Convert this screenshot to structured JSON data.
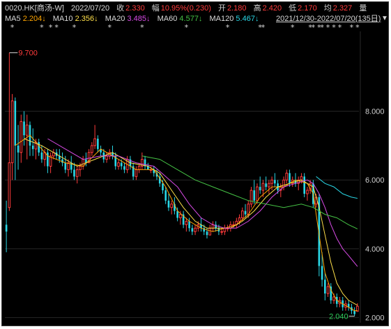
{
  "header": {
    "symbol": "0020.HK[商汤-W]",
    "date": "2022/07/20",
    "close_label": "收",
    "close_value": "2.330",
    "change_label": "幅",
    "change_value": "10.95%(0.230)",
    "open_label": "开",
    "open_value": "2.180",
    "high_label": "高",
    "high_value": "2.420",
    "low_label": "低",
    "low_value": "2.170",
    "avg_label": "均",
    "avg_value": "2.327",
    "volume_label": "量"
  },
  "ma_row": {
    "ma5_label": "MA5",
    "ma5_value": "2.204↓",
    "ma10_label": "MA10",
    "ma10_value": "2.356↓",
    "ma20_label": "MA20",
    "ma20_value": "3.485↓",
    "ma60_label": "MA60",
    "ma60_value": "4.577↓",
    "ma120_label": "MA120",
    "ma120_value": "5.467↓",
    "range_text": "2021/12/30-2022/07/20(135日)",
    "range_caret": "▼"
  },
  "colors": {
    "background": "#000000",
    "up_candle": "#ff3b3b",
    "down_candle": "#29d7e6",
    "ma5": "#ffa500",
    "ma10": "#ffe04a",
    "ma20": "#d84be6",
    "ma60": "#45c245",
    "ma120": "#29d7e6"
  },
  "chart_data": {
    "type": "candlestick",
    "y_ticks": [
      "8.000",
      "6.000",
      "4.000",
      "2.000"
    ],
    "y_tick_values": [
      8,
      6,
      4,
      2
    ],
    "ylim": [
      1.85,
      10.2
    ],
    "annotations": {
      "high_label": "9.700",
      "high_value": 9.7,
      "low_label": "2.040",
      "low_value": 2.04
    },
    "star_marker": "*",
    "star_positions": [
      2,
      12,
      15,
      17,
      23,
      35,
      46,
      61,
      75,
      86,
      87,
      97,
      103,
      104,
      106,
      107,
      109,
      111,
      113,
      117,
      119
    ],
    "candles": [
      [
        4.7,
        5.4,
        3.9,
        4.5
      ],
      [
        5.2,
        9.7,
        5.1,
        6.5
      ],
      [
        6.5,
        8.5,
        6.0,
        8.3
      ],
      [
        8.3,
        8.4,
        6.0,
        7.0
      ],
      [
        7.0,
        7.6,
        6.3,
        6.8
      ],
      [
        6.8,
        7.9,
        6.5,
        7.7
      ],
      [
        7.7,
        8.0,
        7.0,
        7.3
      ],
      [
        7.3,
        7.9,
        6.6,
        7.6
      ],
      [
        7.6,
        7.7,
        6.7,
        7.0
      ],
      [
        7.0,
        7.5,
        6.7,
        6.9
      ],
      [
        6.9,
        7.2,
        6.6,
        7.1
      ],
      [
        7.1,
        7.2,
        6.7,
        6.8
      ],
      [
        6.8,
        7.0,
        6.5,
        6.6
      ],
      [
        6.6,
        6.9,
        6.4,
        6.8
      ],
      [
        6.8,
        6.9,
        6.2,
        6.4
      ],
      [
        6.4,
        6.8,
        6.2,
        6.7
      ],
      [
        6.7,
        6.9,
        6.6,
        6.8
      ],
      [
        6.8,
        6.9,
        6.6,
        6.7
      ],
      [
        6.7,
        6.9,
        6.5,
        6.6
      ],
      [
        6.6,
        6.8,
        6.4,
        6.5
      ],
      [
        6.5,
        6.7,
        6.2,
        6.3
      ],
      [
        6.3,
        6.6,
        6.1,
        6.5
      ],
      [
        6.5,
        6.7,
        6.2,
        6.3
      ],
      [
        6.3,
        6.5,
        6.0,
        6.1
      ],
      [
        6.1,
        6.4,
        5.9,
        6.3
      ],
      [
        6.3,
        6.5,
        6.1,
        6.4
      ],
      [
        6.4,
        6.7,
        6.3,
        6.6
      ],
      [
        6.6,
        6.8,
        6.4,
        6.5
      ],
      [
        6.5,
        6.9,
        6.5,
        6.8
      ],
      [
        6.8,
        7.1,
        6.7,
        7.0
      ],
      [
        7.0,
        7.6,
        6.9,
        7.2
      ],
      [
        7.2,
        7.3,
        6.8,
        6.9
      ],
      [
        6.9,
        7.0,
        6.7,
        6.8
      ],
      [
        6.8,
        6.9,
        6.5,
        6.6
      ],
      [
        6.6,
        6.8,
        6.5,
        6.7
      ],
      [
        6.7,
        6.9,
        6.6,
        6.8
      ],
      [
        6.8,
        7.0,
        6.6,
        6.7
      ],
      [
        6.7,
        6.8,
        6.3,
        6.4
      ],
      [
        6.4,
        6.6,
        6.3,
        6.5
      ],
      [
        6.5,
        6.6,
        6.3,
        6.4
      ],
      [
        6.4,
        6.5,
        6.2,
        6.3
      ],
      [
        6.3,
        6.7,
        6.2,
        6.6
      ],
      [
        6.6,
        6.7,
        6.3,
        6.4
      ],
      [
        6.4,
        6.5,
        6.0,
        6.1
      ],
      [
        6.1,
        6.4,
        6.0,
        6.3
      ],
      [
        6.3,
        6.5,
        6.2,
        6.4
      ],
      [
        6.4,
        6.8,
        6.3,
        6.6
      ],
      [
        6.6,
        6.7,
        6.3,
        6.4
      ],
      [
        6.4,
        6.5,
        6.3,
        6.3
      ],
      [
        6.3,
        6.4,
        6.2,
        6.3
      ],
      [
        6.3,
        6.4,
        6.1,
        6.2
      ],
      [
        6.2,
        6.3,
        6.0,
        6.1
      ],
      [
        6.1,
        6.2,
        5.8,
        5.9
      ],
      [
        5.9,
        6.0,
        5.6,
        5.7
      ],
      [
        5.7,
        5.8,
        5.3,
        5.4
      ],
      [
        5.4,
        5.6,
        5.1,
        5.2
      ],
      [
        5.2,
        5.4,
        5.0,
        5.3
      ],
      [
        5.3,
        5.5,
        5.0,
        5.1
      ],
      [
        5.1,
        5.2,
        4.8,
        4.9
      ],
      [
        4.9,
        5.1,
        4.7,
        5.0
      ],
      [
        5.0,
        5.1,
        4.6,
        4.7
      ],
      [
        4.7,
        4.9,
        4.5,
        4.8
      ],
      [
        4.8,
        4.9,
        4.5,
        4.6
      ],
      [
        4.6,
        4.7,
        4.4,
        4.5
      ],
      [
        4.5,
        4.7,
        4.4,
        4.6
      ],
      [
        4.6,
        4.8,
        4.5,
        4.7
      ],
      [
        4.7,
        4.9,
        4.5,
        4.6
      ],
      [
        4.6,
        4.7,
        4.4,
        4.5
      ],
      [
        4.5,
        4.6,
        4.3,
        4.4
      ],
      [
        4.4,
        4.7,
        4.4,
        4.6
      ],
      [
        4.6,
        4.8,
        4.5,
        4.7
      ],
      [
        4.7,
        4.8,
        4.5,
        4.6
      ],
      [
        4.6,
        4.7,
        4.4,
        4.5
      ],
      [
        4.5,
        4.6,
        4.4,
        4.5
      ],
      [
        4.5,
        4.7,
        4.4,
        4.6
      ],
      [
        4.6,
        4.7,
        4.5,
        4.6
      ],
      [
        4.6,
        4.8,
        4.5,
        4.7
      ],
      [
        4.7,
        4.8,
        4.6,
        4.7
      ],
      [
        4.7,
        4.9,
        4.6,
        4.8
      ],
      [
        4.8,
        5.0,
        4.7,
        4.9
      ],
      [
        4.9,
        5.2,
        4.8,
        5.1
      ],
      [
        5.1,
        5.3,
        4.9,
        5.0
      ],
      [
        5.0,
        5.4,
        4.9,
        5.3
      ],
      [
        5.3,
        5.8,
        5.2,
        5.7
      ],
      [
        5.7,
        6.0,
        5.3,
        5.4
      ],
      [
        5.4,
        5.9,
        5.3,
        5.8
      ],
      [
        5.8,
        6.1,
        5.6,
        5.7
      ],
      [
        5.7,
        6.0,
        5.5,
        5.9
      ],
      [
        5.9,
        6.1,
        5.7,
        5.8
      ],
      [
        5.8,
        6.0,
        5.6,
        5.9
      ],
      [
        5.9,
        6.1,
        5.7,
        6.0
      ],
      [
        6.0,
        6.2,
        5.8,
        5.9
      ],
      [
        5.9,
        6.0,
        5.6,
        5.7
      ],
      [
        5.7,
        5.9,
        5.5,
        5.8
      ],
      [
        5.8,
        6.1,
        5.7,
        6.0
      ],
      [
        6.0,
        6.3,
        5.9,
        6.2
      ],
      [
        6.2,
        6.3,
        5.8,
        5.9
      ],
      [
        5.9,
        6.1,
        5.8,
        6.0
      ],
      [
        6.0,
        6.2,
        5.8,
        5.9
      ],
      [
        5.9,
        6.1,
        5.7,
        6.0
      ],
      [
        6.0,
        6.2,
        5.9,
        6.1
      ],
      [
        6.1,
        6.2,
        5.5,
        5.6
      ],
      [
        5.6,
        5.8,
        5.4,
        5.7
      ],
      [
        5.7,
        6.0,
        5.6,
        5.9
      ],
      [
        5.9,
        6.0,
        5.2,
        5.3
      ],
      [
        5.3,
        5.6,
        5.2,
        5.5
      ],
      [
        5.5,
        5.6,
        3.2,
        3.5
      ],
      [
        3.5,
        3.9,
        2.9,
        3.1
      ],
      [
        3.1,
        3.3,
        2.5,
        2.7
      ],
      [
        2.7,
        3.0,
        2.6,
        2.9
      ],
      [
        2.9,
        3.0,
        2.4,
        2.5
      ],
      [
        2.5,
        2.7,
        2.4,
        2.6
      ],
      [
        2.6,
        2.7,
        2.3,
        2.4
      ],
      [
        2.4,
        2.6,
        2.3,
        2.5
      ],
      [
        2.5,
        2.6,
        2.2,
        2.3
      ],
      [
        2.3,
        2.5,
        2.2,
        2.4
      ],
      [
        2.4,
        2.5,
        2.2,
        2.3
      ],
      [
        2.3,
        2.4,
        2.1,
        2.2
      ],
      [
        2.2,
        2.3,
        2.04,
        2.1
      ],
      [
        2.18,
        2.42,
        2.17,
        2.33
      ]
    ],
    "ma_lines": [
      {
        "name": "MA5",
        "color": "#ffa500",
        "points": [
          [
            3,
            7.0
          ],
          [
            8,
            7.3
          ],
          [
            14,
            6.7
          ],
          [
            20,
            6.5
          ],
          [
            26,
            6.4
          ],
          [
            32,
            6.9
          ],
          [
            38,
            6.6
          ],
          [
            44,
            6.3
          ],
          [
            50,
            6.3
          ],
          [
            54,
            5.8
          ],
          [
            58,
            5.1
          ],
          [
            62,
            4.8
          ],
          [
            66,
            4.6
          ],
          [
            70,
            4.5
          ],
          [
            74,
            4.6
          ],
          [
            78,
            4.7
          ],
          [
            82,
            5.0
          ],
          [
            86,
            5.5
          ],
          [
            90,
            5.8
          ],
          [
            94,
            5.8
          ],
          [
            98,
            6.0
          ],
          [
            102,
            5.9
          ],
          [
            104,
            5.6
          ],
          [
            106,
            4.4
          ],
          [
            108,
            3.3
          ],
          [
            110,
            2.8
          ],
          [
            112,
            2.5
          ],
          [
            114,
            2.4
          ],
          [
            116,
            2.3
          ],
          [
            118,
            2.2
          ],
          [
            119,
            2.204
          ]
        ]
      },
      {
        "name": "MA10",
        "color": "#ffe04a",
        "points": [
          [
            6,
            7.2
          ],
          [
            12,
            7.0
          ],
          [
            18,
            6.7
          ],
          [
            24,
            6.4
          ],
          [
            30,
            6.6
          ],
          [
            36,
            6.8
          ],
          [
            42,
            6.5
          ],
          [
            48,
            6.4
          ],
          [
            52,
            6.2
          ],
          [
            56,
            5.7
          ],
          [
            60,
            5.2
          ],
          [
            64,
            4.8
          ],
          [
            68,
            4.6
          ],
          [
            72,
            4.6
          ],
          [
            76,
            4.6
          ],
          [
            80,
            4.8
          ],
          [
            84,
            5.1
          ],
          [
            88,
            5.5
          ],
          [
            92,
            5.8
          ],
          [
            96,
            5.9
          ],
          [
            100,
            6.0
          ],
          [
            104,
            5.8
          ],
          [
            106,
            5.2
          ],
          [
            108,
            4.4
          ],
          [
            110,
            3.6
          ],
          [
            112,
            3.0
          ],
          [
            114,
            2.7
          ],
          [
            116,
            2.5
          ],
          [
            119,
            2.356
          ]
        ]
      },
      {
        "name": "MA20",
        "color": "#d84be6",
        "points": [
          [
            14,
            7.2
          ],
          [
            20,
            6.9
          ],
          [
            26,
            6.6
          ],
          [
            32,
            6.7
          ],
          [
            38,
            6.7
          ],
          [
            44,
            6.5
          ],
          [
            50,
            6.4
          ],
          [
            54,
            6.1
          ],
          [
            58,
            5.8
          ],
          [
            62,
            5.3
          ],
          [
            66,
            4.9
          ],
          [
            70,
            4.7
          ],
          [
            74,
            4.6
          ],
          [
            78,
            4.6
          ],
          [
            82,
            4.8
          ],
          [
            86,
            5.1
          ],
          [
            90,
            5.5
          ],
          [
            94,
            5.8
          ],
          [
            98,
            5.9
          ],
          [
            102,
            6.0
          ],
          [
            104,
            5.9
          ],
          [
            106,
            5.6
          ],
          [
            108,
            5.2
          ],
          [
            110,
            4.7
          ],
          [
            112,
            4.3
          ],
          [
            114,
            4.0
          ],
          [
            116,
            3.8
          ],
          [
            119,
            3.485
          ]
        ]
      },
      {
        "name": "MA60",
        "color": "#45c245",
        "points": [
          [
            46,
            6.7
          ],
          [
            52,
            6.6
          ],
          [
            58,
            6.3
          ],
          [
            64,
            6.0
          ],
          [
            70,
            5.8
          ],
          [
            76,
            5.6
          ],
          [
            82,
            5.4
          ],
          [
            88,
            5.3
          ],
          [
            94,
            5.2
          ],
          [
            100,
            5.3
          ],
          [
            104,
            5.2
          ],
          [
            108,
            5.0
          ],
          [
            112,
            4.9
          ],
          [
            116,
            4.7
          ],
          [
            119,
            4.577
          ]
        ]
      },
      {
        "name": "MA120",
        "color": "#29d7e6",
        "points": [
          [
            105,
            6.1
          ],
          [
            108,
            5.9
          ],
          [
            111,
            5.8
          ],
          [
            114,
            5.6
          ],
          [
            117,
            5.5
          ],
          [
            119,
            5.467
          ]
        ]
      }
    ]
  }
}
